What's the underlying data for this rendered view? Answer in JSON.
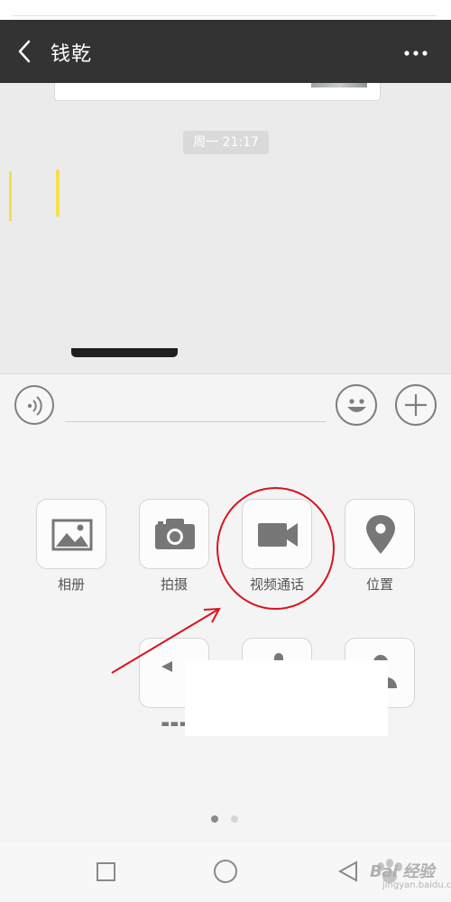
{
  "header": {
    "title": "钱乾"
  },
  "chat": {
    "timestamp": "周一 21:17"
  },
  "panel": {
    "row1": [
      {
        "label": "相册",
        "icon": "photo-album-icon"
      },
      {
        "label": "拍摄",
        "icon": "camera-icon"
      },
      {
        "label": "视频通话",
        "icon": "video-call-icon"
      },
      {
        "label": "位置",
        "icon": "location-icon"
      }
    ],
    "page_indicator": {
      "pages": 2,
      "current": 1
    }
  },
  "watermark": {
    "brand": "Bai 经验",
    "sub": "jingyan.baidu.com"
  },
  "colors": {
    "topbar": "#333333",
    "annotation": "#d9141e",
    "icon": "#777777"
  }
}
